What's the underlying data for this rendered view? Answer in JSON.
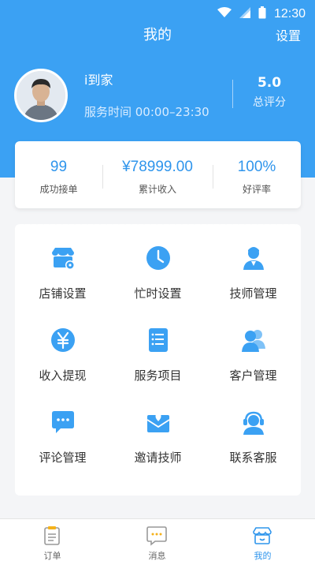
{
  "statusbar": {
    "time": "12:30"
  },
  "header": {
    "title": "我的",
    "settings_label": "设置"
  },
  "profile": {
    "name": "i到家",
    "service_hours": "服务时间 00:00–23:30",
    "rating_value": "5.0",
    "rating_label": "总评分"
  },
  "stats": [
    {
      "value": "99",
      "label": "成功接单"
    },
    {
      "value": "¥78999.00",
      "label": "累计收入"
    },
    {
      "value": "100%",
      "label": "好评率"
    }
  ],
  "menu": [
    {
      "label": "店铺设置",
      "icon": "store-settings-icon"
    },
    {
      "label": "忙时设置",
      "icon": "clock-icon"
    },
    {
      "label": "技师管理",
      "icon": "technician-icon"
    },
    {
      "label": "收入提现",
      "icon": "yuan-icon"
    },
    {
      "label": "服务项目",
      "icon": "service-list-icon"
    },
    {
      "label": "客户管理",
      "icon": "customers-icon"
    },
    {
      "label": "评论管理",
      "icon": "comment-icon"
    },
    {
      "label": "邀请技师",
      "icon": "invite-mail-icon"
    },
    {
      "label": "联系客服",
      "icon": "support-headset-icon"
    }
  ],
  "tabs": [
    {
      "label": "订单",
      "icon": "orders-icon"
    },
    {
      "label": "消息",
      "icon": "messages-icon"
    },
    {
      "label": "我的",
      "icon": "profile-store-icon",
      "active": true
    }
  ],
  "colors": {
    "primary": "#3ba1f3",
    "accent": "#2f95ec"
  }
}
